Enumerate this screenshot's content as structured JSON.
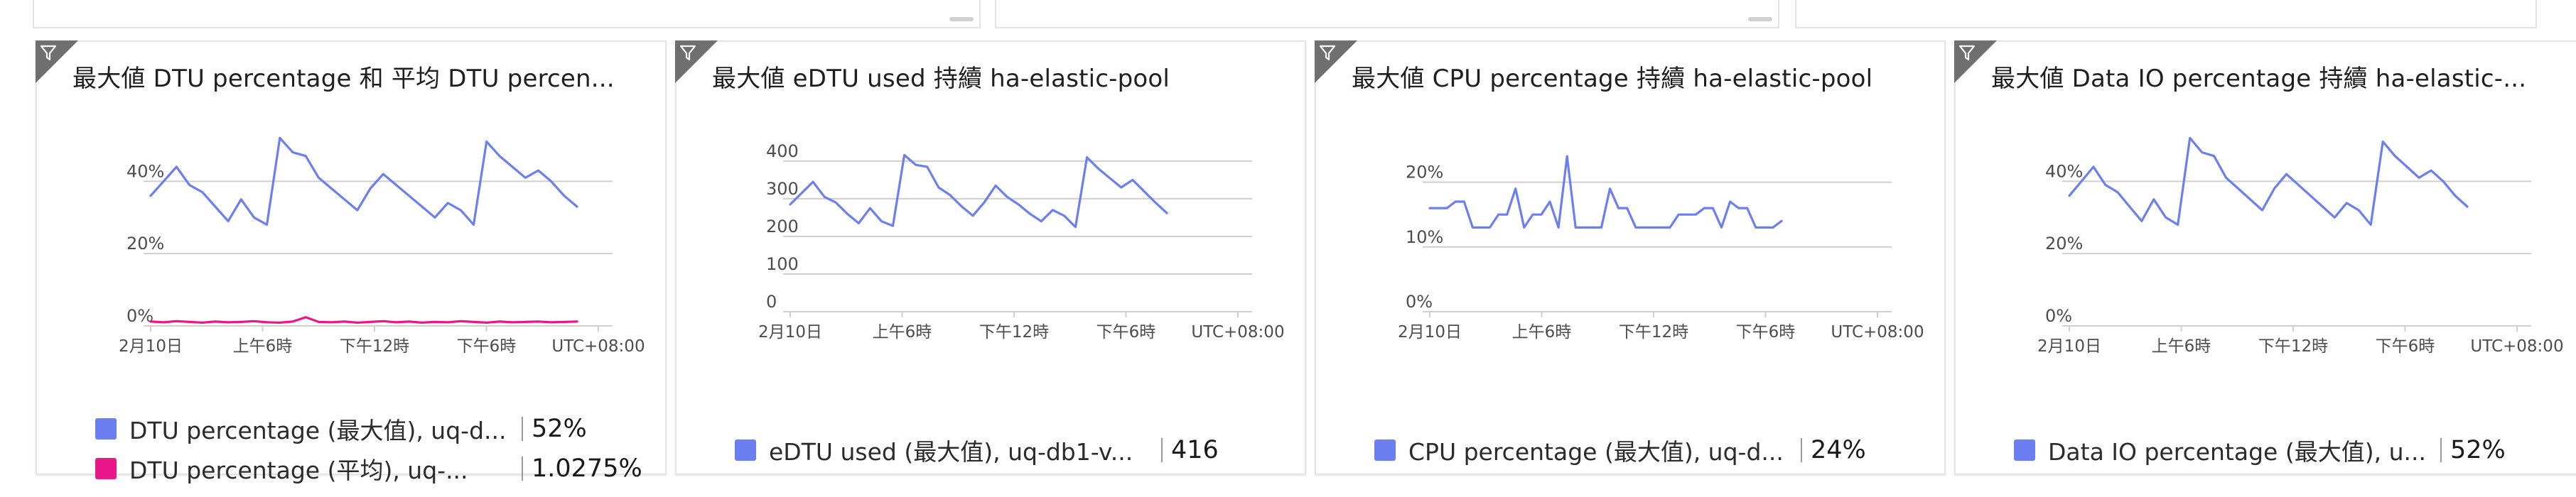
{
  "colors": {
    "blue": "#6b7ff0",
    "magenta": "#e8178a",
    "grid": "#cfcfcf",
    "corner": "#6f6f6f"
  },
  "icons": {
    "tile_corner": "filter-icon"
  },
  "tiles": [
    {
      "title": "最大値 DTU percentage 和 平均 DTU percen...",
      "legend": [
        {
          "name": "DTU percentage (最大值), uq-d...",
          "value": "52%",
          "color": "#6b7ff0"
        },
        {
          "name": "DTU percentage (平均), uq-...",
          "value": "1.0275%",
          "color": "#e8178a"
        }
      ]
    },
    {
      "title": "最大値 eDTU used 持續 ha-elastic-pool",
      "legend": [
        {
          "name": "eDTU used (最大值), uq-db1-v...",
          "value": "416",
          "color": "#6b7ff0"
        }
      ]
    },
    {
      "title": "最大値 CPU percentage 持續 ha-elastic-pool",
      "legend": [
        {
          "name": "CPU percentage (最大值), uq-d...",
          "value": "24%",
          "color": "#6b7ff0"
        }
      ]
    },
    {
      "title": "最大値 Data IO percentage 持續 ha-elastic-...",
      "legend": [
        {
          "name": "Data IO percentage (最大值), u...",
          "value": "52%",
          "color": "#6b7ff0"
        }
      ]
    }
  ],
  "chart_data": [
    {
      "type": "line",
      "x_ticks": [
        "2月10日",
        "上午6時",
        "下午12時",
        "下午6時",
        "UTC+08:00"
      ],
      "y_ticks": [
        "0%",
        "20%",
        "40%"
      ],
      "ylim": [
        0,
        55
      ],
      "series": [
        {
          "name": "DTU percentage (最大值), uq-d...",
          "color": "#6b7ff0",
          "values": [
            36,
            40,
            44,
            39,
            37,
            33,
            29,
            35,
            30,
            28,
            52,
            48,
            47,
            41,
            38,
            35,
            32,
            38,
            42,
            39,
            36,
            33,
            30,
            34,
            32,
            28,
            51,
            47,
            44,
            41,
            43,
            40,
            36,
            33
          ]
        },
        {
          "name": "DTU percentage (平均), uq-...",
          "color": "#e8178a",
          "values": [
            1.2,
            1.0,
            1.3,
            1.1,
            0.9,
            1.2,
            1.0,
            1.1,
            1.3,
            1.0,
            0.9,
            1.2,
            2.4,
            1.1,
            1.0,
            1.2,
            0.9,
            1.1,
            1.3,
            1.0,
            1.2,
            0.9,
            1.1,
            1.0,
            1.3,
            1.1,
            0.9,
            1.2,
            1.0,
            1.1,
            1.2,
            1.0,
            1.1,
            1.2
          ]
        }
      ]
    },
    {
      "type": "line",
      "x_ticks": [
        "2月10日",
        "上午6時",
        "下午12時",
        "下午6時",
        "UTC+08:00"
      ],
      "y_ticks": [
        "0",
        "100",
        "200",
        "300",
        "400"
      ],
      "ylim": [
        0,
        430
      ],
      "series": [
        {
          "name": "eDTU used (最大值), uq-db1-v...",
          "color": "#6b7ff0",
          "values": [
            285,
            315,
            345,
            305,
            290,
            260,
            235,
            275,
            240,
            228,
            416,
            390,
            385,
            330,
            310,
            280,
            255,
            290,
            335,
            305,
            285,
            260,
            240,
            270,
            255,
            225,
            410,
            380,
            355,
            330,
            350,
            320,
            290,
            262
          ]
        }
      ]
    },
    {
      "type": "line",
      "x_ticks": [
        "2月10日",
        "上午6時",
        "下午12時",
        "下午6時",
        "UTC+08:00"
      ],
      "y_ticks": [
        "0%",
        "10%",
        "20%"
      ],
      "ylim": [
        0,
        25
      ],
      "series": [
        {
          "name": "CPU percentage (最大值), uq-d...",
          "color": "#6b7ff0",
          "values": [
            16,
            16,
            16,
            17,
            17,
            13,
            13,
            13,
            15,
            15,
            19,
            13,
            15,
            15,
            17,
            13,
            24,
            13,
            13,
            13,
            13,
            19,
            16,
            16,
            13,
            13,
            13,
            13,
            13,
            15,
            15,
            15,
            16,
            16,
            13,
            17,
            16,
            16,
            13,
            13,
            13,
            14
          ]
        }
      ]
    },
    {
      "type": "line",
      "x_ticks": [
        "2月10日",
        "上午6時",
        "下午12時",
        "下午6時",
        "UTC+08:00"
      ],
      "y_ticks": [
        "0%",
        "20%",
        "40%"
      ],
      "ylim": [
        0,
        55
      ],
      "series": [
        {
          "name": "Data IO percentage (最大值), u...",
          "color": "#6b7ff0",
          "values": [
            36,
            40,
            44,
            39,
            37,
            33,
            29,
            35,
            30,
            28,
            52,
            48,
            47,
            41,
            38,
            35,
            32,
            38,
            42,
            39,
            36,
            33,
            30,
            34,
            32,
            28,
            51,
            47,
            44,
            41,
            43,
            40,
            36,
            33
          ]
        }
      ]
    }
  ]
}
